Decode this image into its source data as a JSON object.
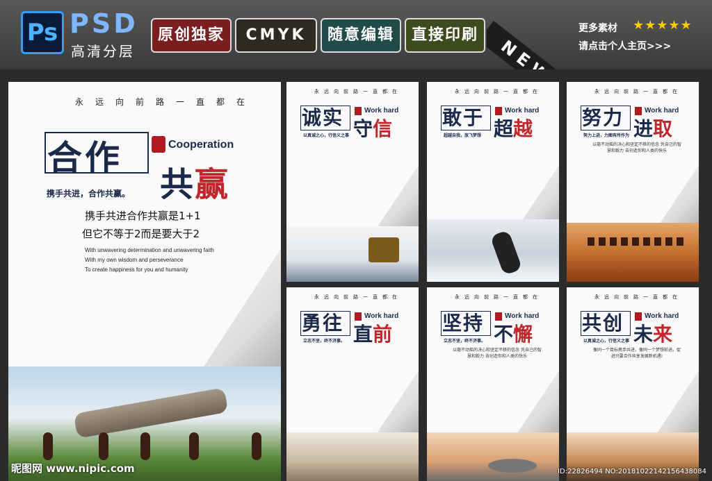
{
  "header": {
    "ps_logo": "Ps",
    "psd_label": "PSD",
    "psd_subtitle": "高清分层",
    "badges": [
      "原创独家",
      "CMYK",
      "随意编辑",
      "直接印刷"
    ],
    "new_ribbon": "NEW",
    "more_line1": "更多素材",
    "stars": "★★★★★",
    "more_line2": "请点击个人主页>>>"
  },
  "main_poster": {
    "vertical_line": "永远向前路一直都在",
    "title_part1": "合作",
    "title_part2_a": "共",
    "title_part2_b": "赢",
    "english_title": "Cooperation",
    "slogan": "携手共进，合作共赢。",
    "line1": "携手共进合作共赢是1+1",
    "line2": "但它不等于2而是要大于2",
    "en_line1": "With unwavering determination and unwavering faith",
    "en_line2": "With my own wisdom and perseverance",
    "en_line3": "To create happiness for you and humanity"
  },
  "posters": [
    {
      "line": "永远向前路一直都在",
      "a": "诚实",
      "b1": "守",
      "b2": "信",
      "wh": "Work hard",
      "slogan": "以真诚之心，行信义之事"
    },
    {
      "line": "永远向前路一直都在",
      "a": "敢于",
      "b1": "超",
      "b2": "越",
      "wh": "Work hard",
      "slogan": "超越自我，放飞梦想"
    },
    {
      "line": "永远向前路一直都在",
      "a": "努力",
      "b1": "进",
      "b2": "取",
      "wh": "Work hard",
      "slogan": "努力上进，力图有所作为",
      "body": "以毫不动摇的决心和坚定不移的信念 凭自己的智慧和毅力 去创造你和人类的快乐"
    },
    {
      "line": "永远向前路一直都在",
      "a": "勇往",
      "b1": "直",
      "b2": "前",
      "wh": "Work hard",
      "slogan": "立志不坚，终不济事。"
    },
    {
      "line": "永远向前路一直都在",
      "a": "坚持",
      "b1": "不",
      "b2": "懈",
      "wh": "Work hard",
      "slogan": "立志不坚，终不济事。",
      "body": "以毫不动摇的决心和坚定不移的信念 凭自己的智慧和毅力 去创造你和人类的快乐"
    },
    {
      "line": "永远向前路一直都在",
      "a": "共创",
      "b1": "未",
      "b2": "来",
      "wh": "Work hard",
      "slogan": "以真诚之心，行信义之事",
      "body": "像同一个目标携手共进，像同一个梦想前进。促进只要合作共享发展新机遇!"
    }
  ],
  "watermark": {
    "left": "昵图网 www.nipic.com",
    "right": "ID:22826494 NO:20181022142156438084"
  }
}
